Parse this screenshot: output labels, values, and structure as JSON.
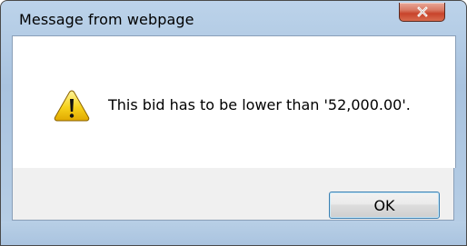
{
  "dialog": {
    "title": "Message from webpage",
    "message": "This bid has to be lower than '52,000.00'.",
    "ok_label": "OK"
  },
  "icons": {
    "close": "close-icon",
    "warning": "warning-icon"
  },
  "colors": {
    "close_button": "#c8432b",
    "warning_yellow": "#f7d21c",
    "frame": "#a9c3df"
  }
}
